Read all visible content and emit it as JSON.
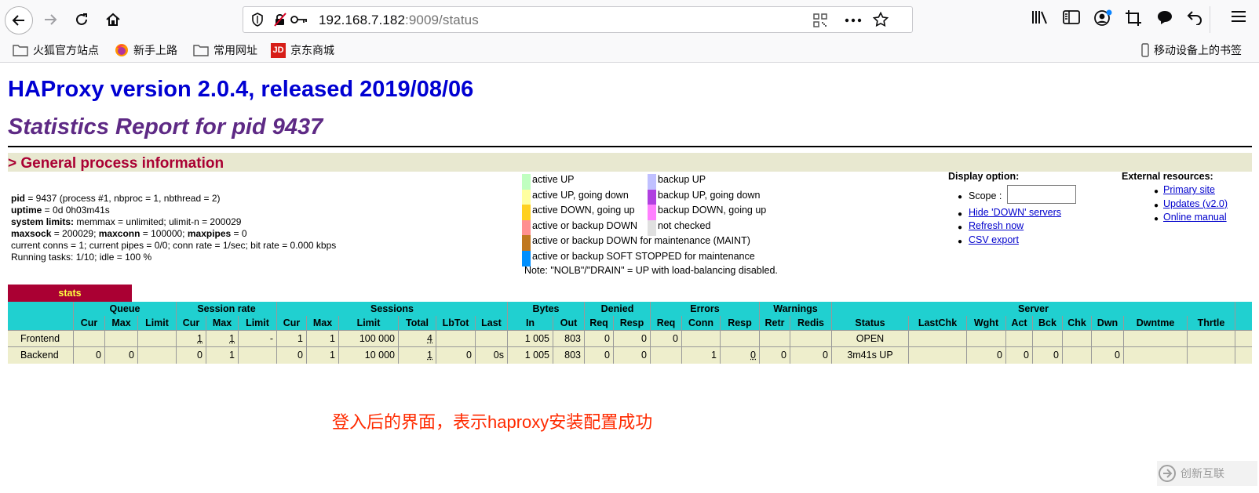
{
  "browser": {
    "url_host": "192.168.7.182",
    "url_port": ":9009/status",
    "bookmarks": [
      "火狐官方站点",
      "新手上路",
      "常用网址",
      "京东商城"
    ],
    "mobile_bookmarks": "移动设备上的书签"
  },
  "page": {
    "title": "HAProxy version 2.0.4, released 2019/08/06",
    "subtitle": "Statistics Report for pid 9437",
    "section": "> General process information"
  },
  "info": {
    "pid_label": "pid",
    "pid_val": " = 9437 (process #1, nbproc = 1, nbthread = 2)",
    "uptime_label": "uptime",
    "uptime_val": " = 0d 0h03m41s",
    "limits_label": "system limits:",
    "limits_val": " memmax = unlimited; ulimit-n = 200029",
    "maxsock_label": "maxsock",
    "maxsock_val": " = 200029; ",
    "maxconn_label": "maxconn",
    "maxconn_val": " = 100000; ",
    "maxpipes_label": "maxpipes",
    "maxpipes_val": " = 0",
    "current": "current conns = 1; current pipes = 0/0; conn rate = 1/sec; bit rate = 0.000 kbps",
    "tasks": "Running tasks: 1/10; idle = 100 %"
  },
  "legend": {
    "left": [
      {
        "label": "active UP",
        "color": "#c0ffc0"
      },
      {
        "label": "active UP, going down",
        "color": "#ffffa0"
      },
      {
        "label": "active DOWN, going up",
        "color": "#ffd020"
      },
      {
        "label": "active or backup DOWN",
        "color": "#ff9090"
      },
      {
        "label": "active or backup DOWN for maintenance (MAINT)",
        "color": "#c07820"
      },
      {
        "label": "active or backup SOFT STOPPED for maintenance",
        "color": "#0090ff"
      }
    ],
    "right": [
      {
        "label": "backup UP",
        "color": "#c0c0ff"
      },
      {
        "label": "backup UP, going down",
        "color": "#b040e0"
      },
      {
        "label": "backup DOWN, going up",
        "color": "#ff80ff"
      },
      {
        "label": "not checked",
        "color": "#e0e0e0"
      }
    ],
    "note": "Note: \"NOLB\"/\"DRAIN\" = UP with load-balancing disabled."
  },
  "display": {
    "title": "Display option:",
    "scope_label": "Scope :",
    "links": [
      "Hide 'DOWN' servers",
      "Refresh now",
      "CSV export"
    ]
  },
  "external": {
    "title": "External resources:",
    "links": [
      "Primary site",
      "Updates (v2.0)",
      "Online manual"
    ]
  },
  "stats": {
    "proxy": "stats",
    "groups": [
      "",
      "Queue",
      "Session rate",
      "Sessions",
      "Bytes",
      "Denied",
      "Errors",
      "Warnings",
      "Server"
    ],
    "columns": [
      "",
      "Cur",
      "Max",
      "Limit",
      "Cur",
      "Max",
      "Limit",
      "Cur",
      "Max",
      "Limit",
      "Total",
      "LbTot",
      "Last",
      "In",
      "Out",
      "Req",
      "Resp",
      "Req",
      "Conn",
      "Resp",
      "Retr",
      "Redis",
      "Status",
      "LastChk",
      "Wght",
      "Act",
      "Bck",
      "Chk",
      "Dwn",
      "Dwntme",
      "Thrtle"
    ],
    "frontend": [
      "Frontend",
      "",
      "",
      "",
      "1",
      "1",
      "-",
      "1",
      "1",
      "100 000",
      "4",
      "",
      "",
      "1 005",
      "803",
      "0",
      "0",
      "0",
      "",
      "",
      "",
      "",
      "OPEN",
      "",
      "",
      "",
      "",
      "",
      "",
      "",
      ""
    ],
    "backend": [
      "Backend",
      "0",
      "0",
      "",
      "0",
      "1",
      "",
      "0",
      "1",
      "10 000",
      "1",
      "0",
      "0s",
      "1 005",
      "803",
      "0",
      "0",
      "",
      "1",
      "0",
      "0",
      "0",
      "3m41s UP",
      "",
      "0",
      "0",
      "0",
      "",
      "0",
      "",
      ""
    ]
  },
  "caption": "登入后的界面，表示haproxy安装配置成功",
  "watermark": "创新互联"
}
